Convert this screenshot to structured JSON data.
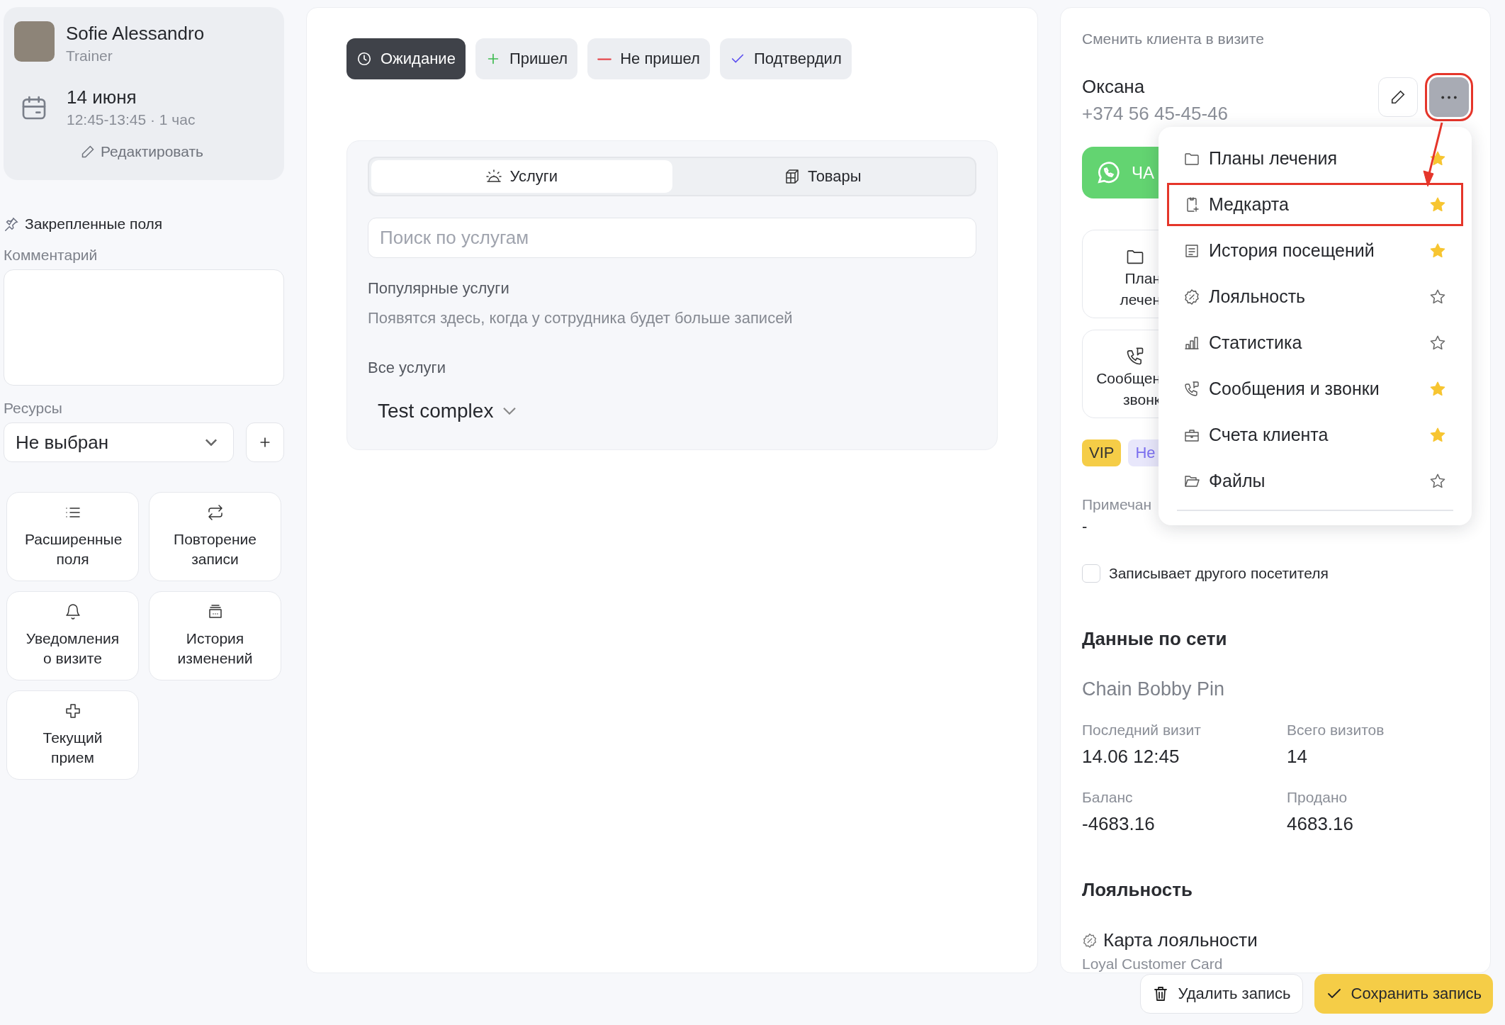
{
  "staff": {
    "name": "Sofie Alessandro",
    "role": "Trainer"
  },
  "appointment": {
    "date": "14 июня",
    "time": "12:45-13:45 · 1 час",
    "edit_link": "Редактировать"
  },
  "pinned_fields": {
    "title": "Закрепленные поля",
    "comment": {
      "label": "Комментарий"
    },
    "resources": {
      "label": "Ресурсы",
      "value": "Не выбран"
    }
  },
  "tiles": [
    {
      "kind": "list",
      "label": "Расширенные поля"
    },
    {
      "kind": "repeat",
      "label": "Повторение записи"
    },
    {
      "kind": "bell",
      "label": "Уведомления о визите"
    },
    {
      "kind": "history",
      "label": "История изменений"
    },
    {
      "kind": "cross",
      "label": "Текущий прием"
    }
  ],
  "status_buttons": [
    {
      "kind": "waiting",
      "label": "Ожидание",
      "selected": true
    },
    {
      "kind": "arrived",
      "label": "Пришел",
      "selected": false
    },
    {
      "kind": "missed",
      "label": "Не пришел",
      "selected": false
    },
    {
      "kind": "confirmed",
      "label": "Подтвердил",
      "selected": false
    }
  ],
  "catalog": {
    "tabs": [
      {
        "kind": "services",
        "label": "Услуги",
        "selected": true
      },
      {
        "kind": "goods",
        "label": "Товары",
        "selected": false
      }
    ],
    "search": {
      "placeholder": "Поиск по услугам"
    },
    "popular": {
      "title": "Популярные услуги",
      "hint": "Появятся здесь, когда у сотрудника будет больше записей"
    },
    "all": {
      "title": "Все услуги",
      "category": "Test complex"
    }
  },
  "client": {
    "section_title": "Сменить клиента в визите",
    "name": "Оксана",
    "phone": "+374 56 45-45-46",
    "more_highlighted": true,
    "chat_button": "ЧА",
    "cards": [
      {
        "kind": "folder",
        "lines": [
          "План",
          "лечен"
        ]
      },
      {
        "kind": "chat-phone",
        "lines": [
          "Сообщен",
          "звонк"
        ]
      }
    ],
    "tags": [
      {
        "label": "VIP",
        "color": "#f5cd47"
      },
      {
        "label": "Не",
        "color": "#e8e7fb"
      }
    ],
    "note": {
      "label": "Примечан",
      "value": "-"
    },
    "other_visitor": {
      "label": "Записывает другого посетителя",
      "checked": false
    }
  },
  "menu": {
    "items": [
      {
        "kind": "folder",
        "label": "Планы лечения",
        "favorite": true,
        "highlighted": false
      },
      {
        "kind": "medcard",
        "label": "Медкарта",
        "favorite": true,
        "highlighted": true
      },
      {
        "kind": "visits",
        "label": "История посещений",
        "favorite": true,
        "highlighted": false
      },
      {
        "kind": "loyalty",
        "label": "Лояльность",
        "favorite": false,
        "highlighted": false
      },
      {
        "kind": "stats",
        "label": "Статистика",
        "favorite": false,
        "highlighted": false
      },
      {
        "kind": "chat-phone",
        "label": "Сообщения и звонки",
        "favorite": true,
        "highlighted": false
      },
      {
        "kind": "briefcase",
        "label": "Счета клиента",
        "favorite": true,
        "highlighted": false
      },
      {
        "kind": "folder-open",
        "label": "Файлы",
        "favorite": false,
        "highlighted": false
      }
    ]
  },
  "network": {
    "title": "Данные по сети",
    "chain": "Chain Bobby Pin",
    "stats": [
      {
        "label": "Последний визит",
        "value": "14.06 12:45"
      },
      {
        "label": "Всего визитов",
        "value": "14"
      },
      {
        "label": "Баланс",
        "value": "-4683.16"
      },
      {
        "label": "Продано",
        "value": "4683.16"
      }
    ]
  },
  "loyalty": {
    "title": "Лояльность",
    "card": "Карта лояльности",
    "card_type": "Loyal Customer Card"
  },
  "actions": [
    {
      "kind": "delete",
      "label": "Удалить запись"
    },
    {
      "kind": "save",
      "label": "Сохранить запись"
    }
  ]
}
